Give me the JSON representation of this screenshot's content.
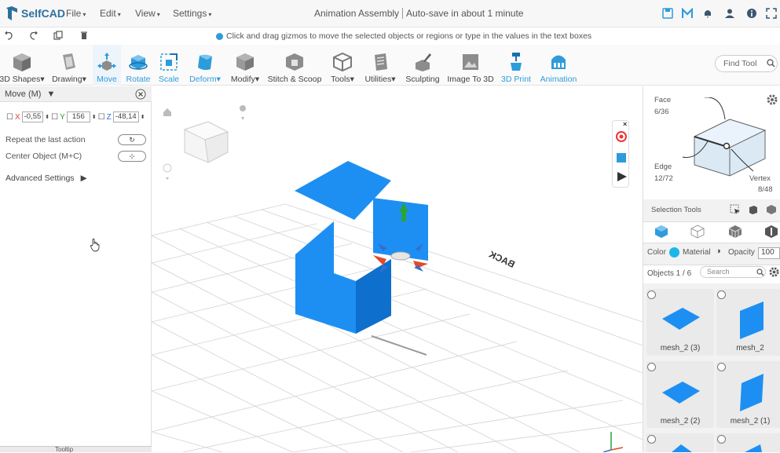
{
  "app": {
    "name": "SelfCAD"
  },
  "menus": [
    {
      "label": "File",
      "caret": "▾"
    },
    {
      "label": "Edit",
      "caret": "▾"
    },
    {
      "label": "View",
      "caret": "▾"
    },
    {
      "label": "Settings",
      "caret": "▾"
    }
  ],
  "document": {
    "title": "Animation Assembly",
    "autosave": "Auto-save in about 1 minute"
  },
  "hint": "Click and drag gizmos to move the selected objects or regions or type in the values in the text boxes",
  "tools": [
    {
      "label": "3D Shapes",
      "caret": "▾"
    },
    {
      "label": "Drawing",
      "caret": "▾"
    },
    {
      "label": "Move",
      "caret": ""
    },
    {
      "label": "Rotate",
      "caret": ""
    },
    {
      "label": "Scale",
      "caret": ""
    },
    {
      "label": "Deform",
      "caret": "▾"
    },
    {
      "label": "Modify",
      "caret": "▾"
    },
    {
      "label": "Stitch & Scoop",
      "caret": ""
    },
    {
      "label": "Tools",
      "caret": "▾"
    },
    {
      "label": "Utilities",
      "caret": "▾"
    },
    {
      "label": "Sculpting",
      "caret": ""
    },
    {
      "label": "Image To 3D",
      "caret": ""
    },
    {
      "label": "3D Print",
      "caret": ""
    },
    {
      "label": "Animation",
      "caret": ""
    }
  ],
  "find_tool": {
    "placeholder": "Find Tool"
  },
  "move_panel": {
    "title": "Move (M)",
    "x_label": "X",
    "x_value": "-0,55",
    "y_label": "Y",
    "y_value": "156",
    "z_label": "Z",
    "z_value": "-48,14",
    "repeat_label": "Repeat the last action",
    "center_label": "Center Object (M+C)",
    "advanced_label": "Advanced Settings",
    "tooltip_label": "Tooltip"
  },
  "viewport": {
    "back_label": "BACK"
  },
  "right_panel": {
    "face_label": "Face",
    "face_count": "6/36",
    "edge_label": "Edge",
    "edge_count": "12/72",
    "vertex_label": "Vertex",
    "vertex_count": "8/48",
    "selection_tools_label": "Selection Tools",
    "color_label": "Color",
    "material_label": "Material",
    "opacity_label": "Opacity",
    "opacity_value": "100",
    "objects_label": "Objects 1 / 6",
    "search_placeholder": "Search",
    "objects": [
      {
        "name": "mesh_2 (3)"
      },
      {
        "name": "mesh_2"
      },
      {
        "name": "mesh_2 (2)"
      },
      {
        "name": "mesh_2 (1)"
      }
    ]
  },
  "colors": {
    "accent": "#2d9cdb",
    "mesh": "#1e8ff2",
    "mesh_dark": "#0f6fcc"
  }
}
